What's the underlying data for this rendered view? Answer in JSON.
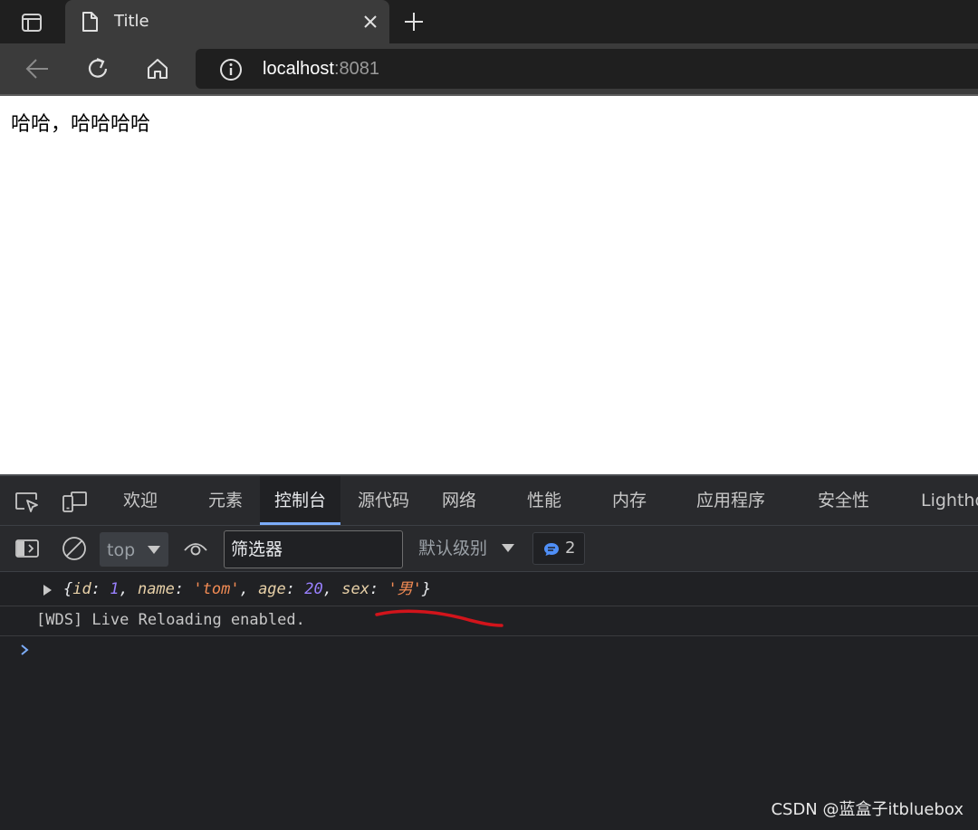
{
  "browser": {
    "tab": {
      "title": "Title"
    },
    "address": {
      "host": "localhost",
      "port": ":8081"
    },
    "icons": [
      "tab-actions-icon",
      "page-icon",
      "close-icon",
      "plus-icon",
      "back-arrow-icon",
      "reload-icon",
      "home-icon",
      "info-icon"
    ]
  },
  "page": {
    "content": "哈哈，哈哈哈哈"
  },
  "devtools": {
    "tabs": [
      "欢迎",
      "元素",
      "控制台",
      "源代码",
      "网络",
      "性能",
      "内存",
      "应用程序",
      "安全性",
      "Lighthouse"
    ],
    "active_tab": "控制台",
    "toolbar": {
      "context": "top",
      "filter_placeholder": "筛选器",
      "level": "默认级别",
      "message_count": "2"
    },
    "console": {
      "object_log": {
        "open": "{",
        "entries": [
          {
            "key": "id",
            "value": "1",
            "type": "number"
          },
          {
            "key": "name",
            "value": "'tom'",
            "type": "string"
          },
          {
            "key": "age",
            "value": "20",
            "type": "number"
          },
          {
            "key": "sex",
            "value": "'男'",
            "type": "string"
          }
        ],
        "close": "}"
      },
      "wds_message": "[WDS] Live Reloading enabled."
    },
    "colors": {
      "accent": "#7cacf8",
      "number": "#9980ff",
      "string": "#f28b54",
      "annotation": "#d2141b"
    }
  },
  "watermark": "CSDN @蓝盒子itbluebox"
}
